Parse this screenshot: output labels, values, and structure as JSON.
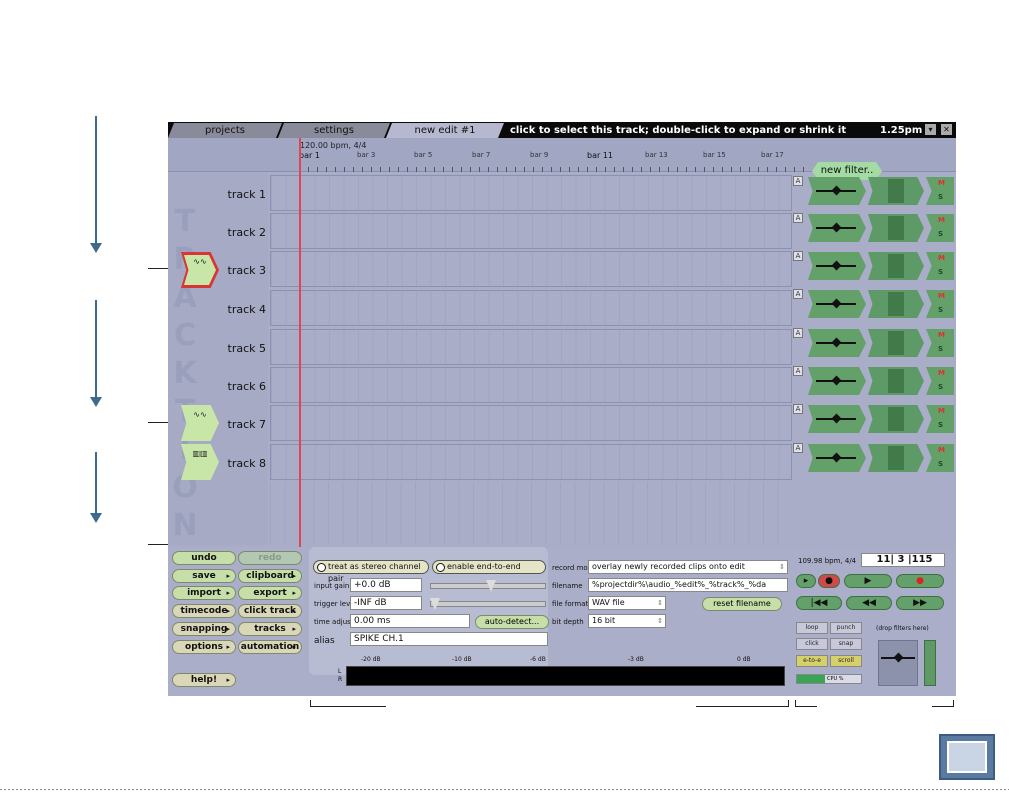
{
  "tabs": [
    "projects",
    "settings",
    "new edit #1"
  ],
  "status_message": "click to select this track; double-click to expand or shrink it",
  "clock": "1.25pm",
  "ruler": {
    "tempo": "120.00 bpm, 4/4",
    "bars": [
      "bar 1",
      "bar 3",
      "bar 5",
      "bar 7",
      "bar 9",
      "bar 11",
      "bar 13",
      "bar 15",
      "bar 17"
    ]
  },
  "new_filter_label": "new filter..",
  "watermark": "TRACKTION",
  "tracks": [
    "track 1",
    "track 2",
    "track 3",
    "track 4",
    "track 5",
    "track 6",
    "track 7",
    "track 8"
  ],
  "auto_badge": "A",
  "mute_label": "M",
  "solo_label": "S",
  "left_buttons": {
    "undo": "undo",
    "redo": "redo",
    "save": "save",
    "clipboard": "clipboard",
    "import": "import",
    "export": "export",
    "timecode": "timecode",
    "click_track": "click track",
    "snapping": "snapping",
    "tracks": "tracks",
    "options": "options",
    "automation": "automation",
    "help": "help!"
  },
  "input": {
    "stereo_pair": "treat as stereo channel pair",
    "end_to_end": "enable end-to-end",
    "input_gain_label": "input gain",
    "input_gain_value": "+0.0 dB",
    "trigger_level_label": "trigger level",
    "trigger_level_value": "-INF dB",
    "time_adjust_label": "time adjust",
    "time_adjust_value": "0.00 ms",
    "auto_detect": "auto-detect...",
    "alias_label": "alias",
    "alias_value": "SPIKE CH.1"
  },
  "record": {
    "record_mode_label": "record mode",
    "record_mode_value": "overlay newly recorded clips onto edit",
    "filename_label": "filename",
    "filename_value": "%projectdir%\\audio_%edit%_%track%_%da",
    "reset_filename": "reset filename",
    "file_format_label": "file format",
    "file_format_value": "WAV file",
    "bit_depth_label": "bit depth",
    "bit_depth_value": "16 bit"
  },
  "meter": {
    "db_labels": [
      "-20 dB",
      "-10 dB",
      "-6 dB",
      "-3 dB",
      "0 dB"
    ],
    "channels": [
      "L",
      "R"
    ]
  },
  "transport": {
    "tempo": "109.98 bpm, 4/4",
    "position": "11| 3 |115",
    "loop": "loop",
    "punch": "punch",
    "click": "click",
    "snap": "snap",
    "e_to_e": "e-to-e",
    "scroll": "scroll",
    "cpu": "CPU %",
    "drop_filters": "(drop filters here)"
  }
}
